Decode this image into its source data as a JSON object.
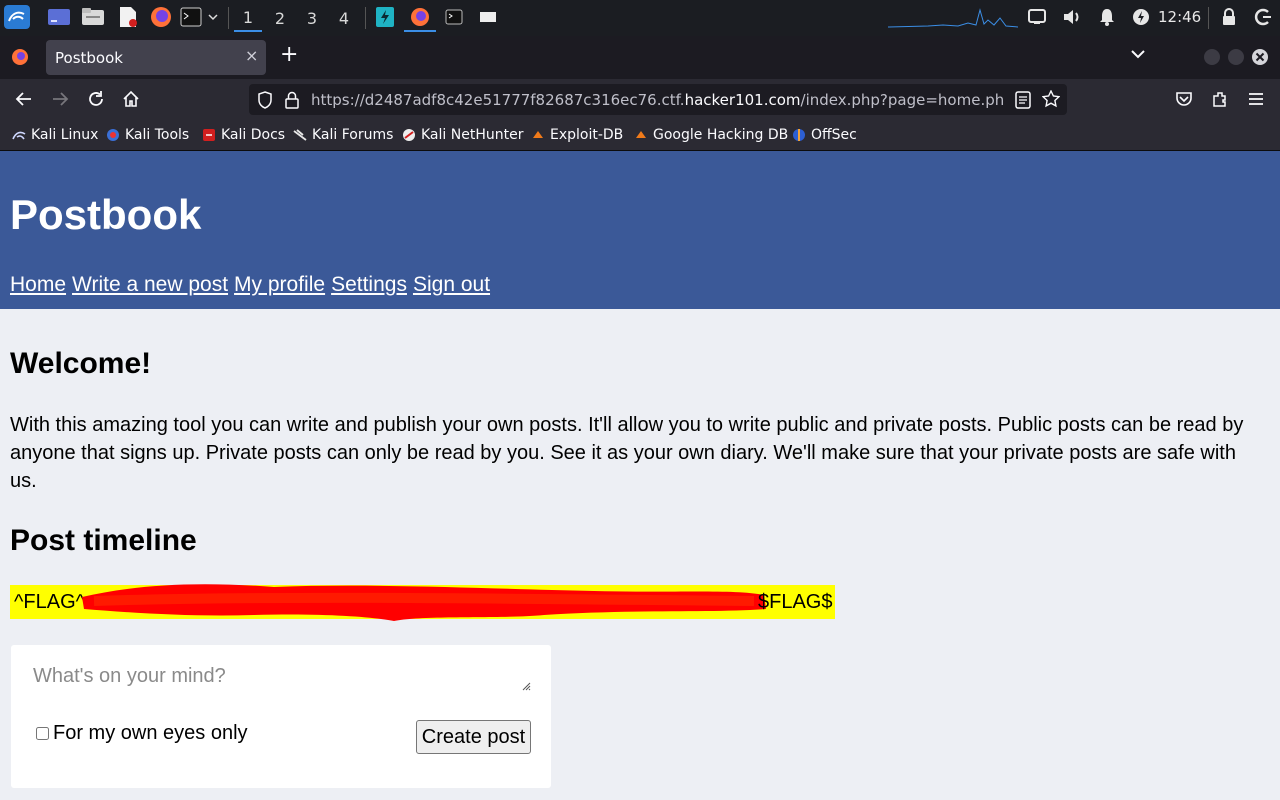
{
  "taskbar": {
    "workspaces": [
      "1",
      "2",
      "3",
      "4"
    ],
    "active_workspace": "1",
    "clock": "12:46",
    "accent_color": "#3b8ee6"
  },
  "browser": {
    "tab_title": "Postbook",
    "tab_close": "×",
    "new_tab": "+",
    "url_prefix": "https://d2487adf8c42e51777f82687c316ec76.ctf.",
    "url_domain": "hacker101.com",
    "url_suffix": "/index.php?page=home.php&message",
    "bookmarks": [
      {
        "label": "Kali Linux",
        "icon": "kali-dragon-icon"
      },
      {
        "label": "Kali Tools",
        "icon": "kali-tools-icon"
      },
      {
        "label": "Kali Docs",
        "icon": "kali-docs-icon"
      },
      {
        "label": "Kali Forums",
        "icon": "kali-forums-icon"
      },
      {
        "label": "Kali NetHunter",
        "icon": "nethunter-icon"
      },
      {
        "label": "Exploit-DB",
        "icon": "exploit-db-icon"
      },
      {
        "label": "Google Hacking DB",
        "icon": "ghdb-icon"
      },
      {
        "label": "OffSec",
        "icon": "offsec-icon"
      }
    ]
  },
  "site": {
    "title": "Postbook",
    "nav": [
      "Home",
      "Write a new post",
      "My profile",
      "Settings",
      "Sign out"
    ],
    "header_color": "#3b5998",
    "welcome_heading": "Welcome!",
    "intro": "With this amazing tool you can write and publish your own posts. It'll allow you to write public and private posts. Public posts can be read by anyone that signs up. Private posts can only be read by you. See it as your own diary. We'll make sure that your private posts are safe with us.",
    "timeline_heading": "Post timeline",
    "flag_start": "^FLAG^",
    "flag_end": "$FLAG$",
    "flag_highlight_color": "#ffff00",
    "redaction_color": "#ff0000",
    "post_form": {
      "placeholder": "What's on your mind?",
      "private_label": "For my own eyes only",
      "submit_label": "Create post"
    }
  }
}
